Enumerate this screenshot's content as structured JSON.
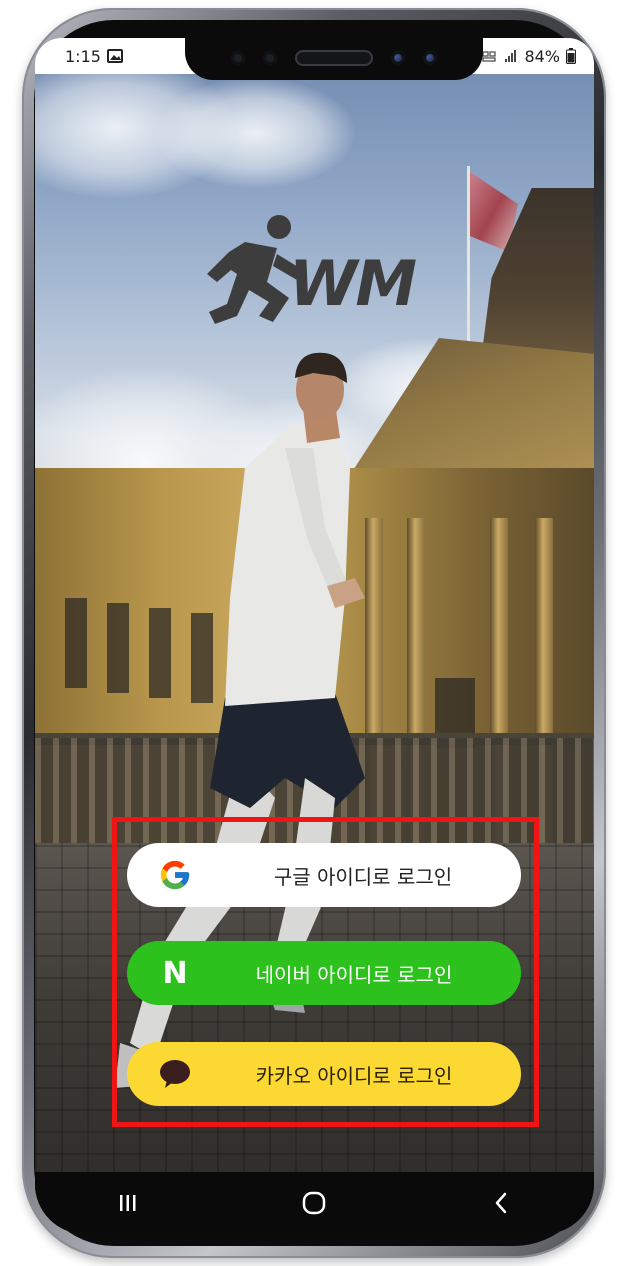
{
  "status_bar": {
    "time": "1:15",
    "battery": "84%"
  },
  "logo": {
    "text": "WM"
  },
  "login": {
    "google_label": "구글 아이디로 로그인",
    "naver_label": "네이버 아이디로 로그인",
    "kakao_label": "카카오 아이디로 로그인",
    "naver_icon_letter": "N"
  },
  "icons": {
    "google": "google-g-icon",
    "naver": "naver-n-icon",
    "kakao": "kakao-speech-bubble-icon",
    "recent_apps": "recent-apps-icon",
    "home": "home-icon",
    "back": "back-icon"
  },
  "colors": {
    "google_button": "#ffffff",
    "naver_button": "#2dc11d",
    "kakao_button": "#fbd932",
    "highlight": "#f01414"
  }
}
